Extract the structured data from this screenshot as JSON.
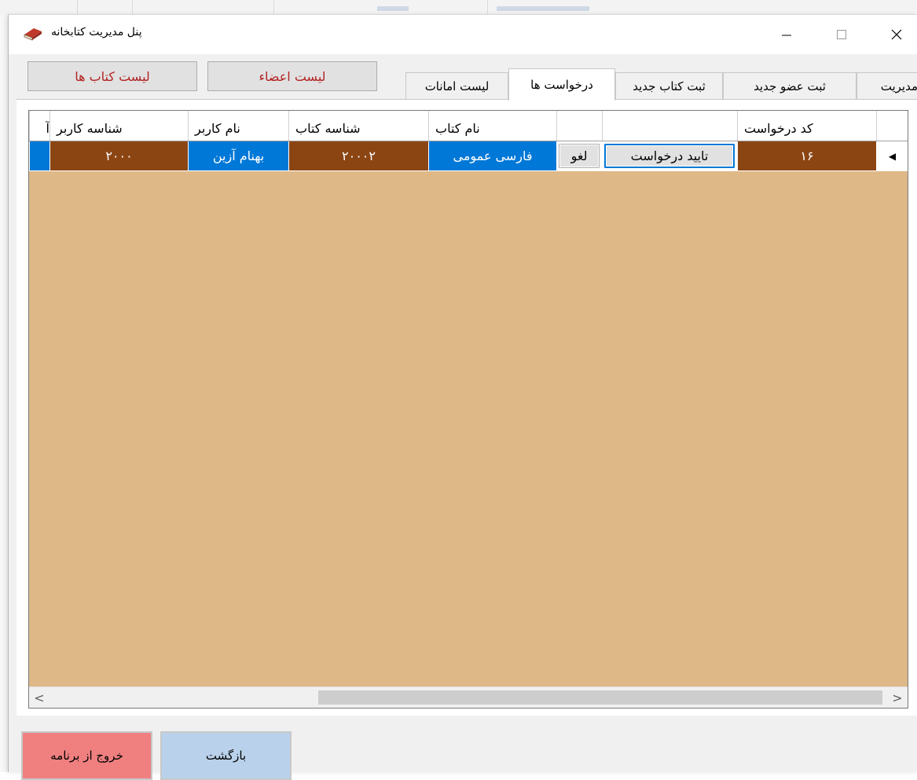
{
  "window": {
    "title": "پنل مدیریت کتابخانه",
    "controls": {
      "minimize": "—",
      "maximize": "☐",
      "close": "✕"
    }
  },
  "top_buttons": {
    "books_list": "لیست کتاب ها",
    "members_list": "لیست اعضاء"
  },
  "tabs": [
    {
      "label": "لیست امانات",
      "active": false
    },
    {
      "label": "درخواست ها",
      "active": true
    },
    {
      "label": "ثبت کتاب جدید",
      "active": false
    },
    {
      "label": "ثبت عضو جدید",
      "active": false
    },
    {
      "label": "مدیریت",
      "active": false
    }
  ],
  "grid": {
    "headers": {
      "request_code": "کد درخواست",
      "approve_col": "",
      "cancel_col": "",
      "book_name": "نام کتاب",
      "book_id": "شناسه کتاب",
      "user_name": "نام کاربر",
      "user_id": "شناسه کاربر",
      "overflow": "آ"
    },
    "rows": [
      {
        "request_code": "۱۶",
        "approve_label": "تایید درخواست",
        "cancel_label": "لغو",
        "book_name": "فارسی عمومی",
        "book_id": "۲۰۰۰۲",
        "user_name": "بهنام آزین",
        "user_id": "۲۰۰۰"
      }
    ],
    "row_indicator": "◀",
    "scroll_left": "<",
    "scroll_right": ">"
  },
  "bottom_buttons": {
    "exit": "خروج از برنامه",
    "back": "بازگشت"
  },
  "colors": {
    "grid_background": "#deb887",
    "cell_brown": "#8b4513",
    "cell_blue": "#0078d7",
    "top_button_text": "#b22222",
    "exit_button": "#f08080",
    "back_button": "#b9d1ea"
  }
}
